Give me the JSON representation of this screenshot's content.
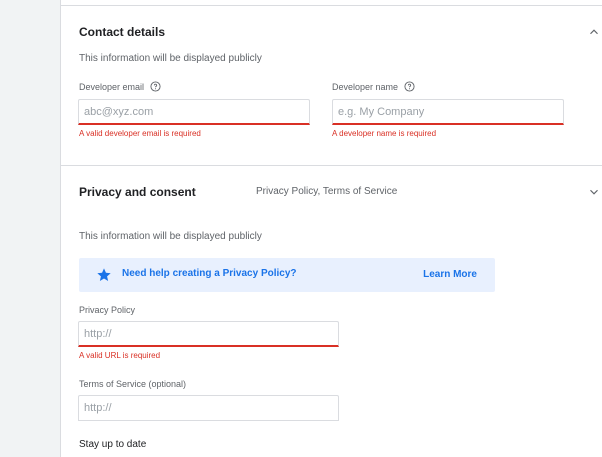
{
  "contact": {
    "title": "Contact details",
    "subtitle": "This information will be displayed publicly",
    "email_label": "Developer email",
    "email_placeholder": "abc@xyz.com",
    "email_error": "A valid developer email is required",
    "name_label": "Developer name",
    "name_placeholder": "e.g. My Company",
    "name_error": "A developer name is required"
  },
  "privacy": {
    "title": "Privacy and consent",
    "summary": "Privacy Policy, Terms of Service",
    "subtitle": "This information will be displayed publicly",
    "banner_text": "Need help creating a Privacy Policy?",
    "banner_link": "Learn More",
    "policy_label": "Privacy Policy",
    "policy_placeholder": "http://",
    "policy_error": "A valid URL is required",
    "terms_label": "Terms of Service (optional)",
    "terms_placeholder": "http://",
    "stay_title": "Stay up to date"
  },
  "icons": {
    "collapse": "chevron-up-icon",
    "expand": "chevron-down-icon",
    "help": "help-circle-icon",
    "star": "star-icon"
  },
  "colors": {
    "accent": "#1a73e8",
    "error": "#d93025",
    "banner_bg": "#e8f0fe",
    "page_bg": "#f1f3f4"
  }
}
